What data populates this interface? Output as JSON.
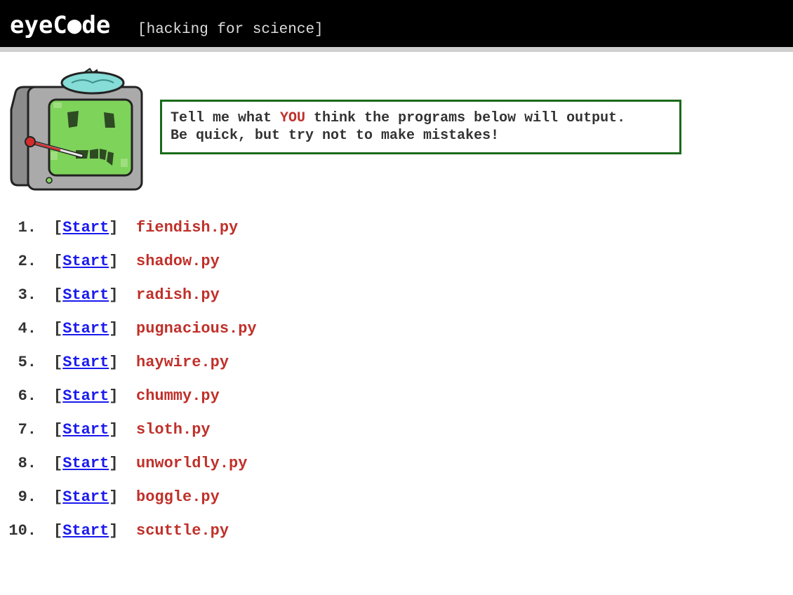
{
  "header": {
    "logo_text": "eyeC●de",
    "tagline": "[hacking for science]",
    "background": "#000000"
  },
  "mascot": {
    "icon": "sick-computer-mascot-icon"
  },
  "instructions": {
    "line1_before": "Tell me what ",
    "line1_highlight": "YOU",
    "line1_after": " think the programs below will output.",
    "line2": "Be quick, but try not to make mistakes!",
    "highlight_color": "#c0302a",
    "border_color": "#1a6a1a"
  },
  "tasks": [
    {
      "number": "1.",
      "link_label": "Start",
      "filename": "fiendish.py"
    },
    {
      "number": "2.",
      "link_label": "Start",
      "filename": "shadow.py"
    },
    {
      "number": "3.",
      "link_label": "Start",
      "filename": "radish.py"
    },
    {
      "number": "4.",
      "link_label": "Start",
      "filename": "pugnacious.py"
    },
    {
      "number": "5.",
      "link_label": "Start",
      "filename": "haywire.py"
    },
    {
      "number": "6.",
      "link_label": "Start",
      "filename": "chummy.py"
    },
    {
      "number": "7.",
      "link_label": "Start",
      "filename": "sloth.py"
    },
    {
      "number": "8.",
      "link_label": "Start",
      "filename": "unworldly.py"
    },
    {
      "number": "9.",
      "link_label": "Start",
      "filename": "boggle.py"
    },
    {
      "number": "10.",
      "link_label": "Start",
      "filename": "scuttle.py"
    }
  ],
  "colors": {
    "link": "#1a1aee",
    "filename": "#c0302a",
    "text": "#333333"
  }
}
